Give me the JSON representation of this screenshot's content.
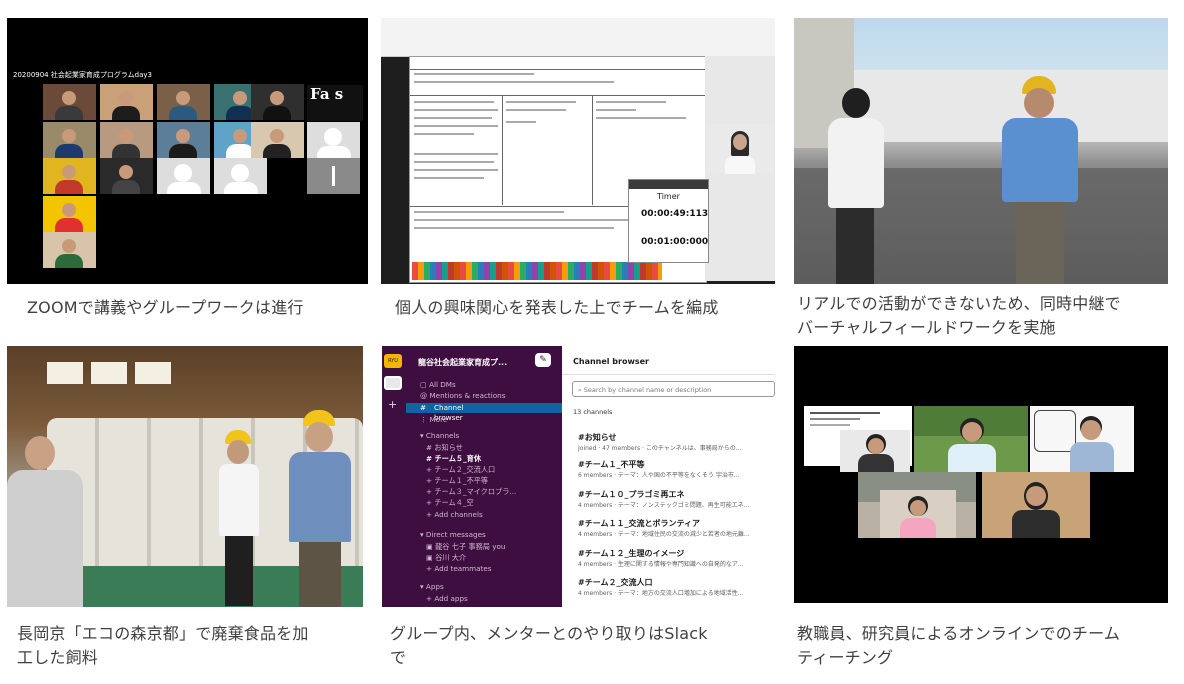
{
  "captions": {
    "zoom_lecture": "ZOOMで講義やグループワークは進行",
    "team_formation": "個人の興味関心を発表した上でチームを編成",
    "virtual_fieldwork_line1": "リアルでの活動ができないため、同時中継で",
    "virtual_fieldwork_line2": "バーチャルフィールドワークを実施",
    "eco_forest_line1": "長岡京「エコの森京都」で廃棄食品を加",
    "eco_forest_line2": "工した飼料",
    "slack_line1": "グループ内、メンターとのやり取りはSlack",
    "slack_line2": "で",
    "team_teaching_line1": "教職員、研究員によるオンラインでのチーム",
    "team_teaching_line2": "ティーチング"
  },
  "zoom_screen": {
    "session_label": "20200904 社会起業家育成プログラムday3",
    "logo_text": "Fa     s"
  },
  "presentation": {
    "timer_title": "Timer",
    "elapsed": "00:00:49:113",
    "limit": "00:01:00:000"
  },
  "slack": {
    "workspace": "龍谷社会起業家育成プ...",
    "sidebar": {
      "all_dms": "All DMs",
      "mentions": "Mentions & reactions",
      "channel_browser": "Channel browser",
      "more": "More",
      "channels_header": "Channels",
      "channels": [
        "お知らせ",
        "チーム５_育休",
        "チーム２_交流人口",
        "チーム１_不平等",
        "チーム３_マイクロプラ...",
        "チーム４_空"
      ],
      "add_channels": "Add channels",
      "dm_header": "Direct messages",
      "dm_user1": "龍谷 七子  事務局  you",
      "dm_user2": "谷川 大介",
      "add_teammates": "Add teammates",
      "apps_header": "Apps",
      "add_apps": "Add apps"
    },
    "main": {
      "title": "Channel browser",
      "search_placeholder": "Search by channel name or description",
      "count": "13 channels",
      "list": [
        {
          "name": "#お知らせ",
          "meta": "Joined · 47 members · このチャンネルは、事務局からの..."
        },
        {
          "name": "#チーム１_不平等",
          "meta": "6 members · テーマ：人や国の不平等をなくそう 宇治市..."
        },
        {
          "name": "#チーム１０_プラゴミ再エネ",
          "meta": "4 members · テーマ：ノンステックゴミ問題、再生可能エネ..."
        },
        {
          "name": "#チーム１１_交流とボランティア",
          "meta": "4 members · テーマ：地域住民の交流の減少と若者の地元離..."
        },
        {
          "name": "#チーム１２_生理のイメージ",
          "meta": "4 members · 生理に関する情報や専門知識への自発的なア..."
        },
        {
          "name": "#チーム２_交流人口",
          "meta": "4 members · テーマ：地方の交流人口増加による地域活性..."
        }
      ]
    }
  }
}
